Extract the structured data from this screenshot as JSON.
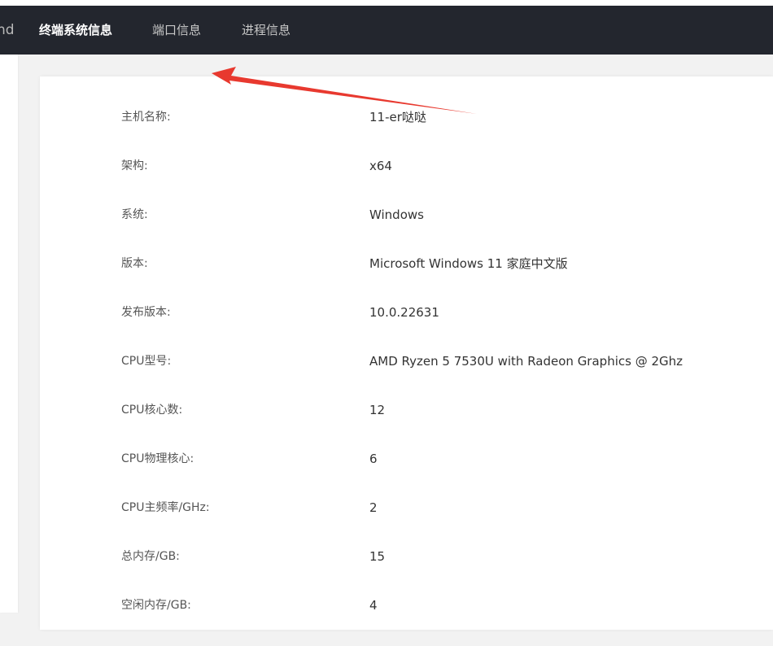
{
  "navbar": {
    "brand": "nd",
    "items": [
      {
        "label": "终端系统信息",
        "active": true
      },
      {
        "label": "端口信息",
        "active": false
      },
      {
        "label": "进程信息",
        "active": false
      }
    ]
  },
  "info": {
    "rows": [
      {
        "label": "主机名称:",
        "value": "11-er哒哒"
      },
      {
        "label": "架构:",
        "value": "x64"
      },
      {
        "label": "系统:",
        "value": "Windows"
      },
      {
        "label": "版本:",
        "value": "Microsoft Windows 11 家庭中文版"
      },
      {
        "label": "发布版本:",
        "value": "10.0.22631"
      },
      {
        "label": "CPU型号:",
        "value": "AMD Ryzen 5 7530U with Radeon Graphics @ 2Ghz"
      },
      {
        "label": "CPU核心数:",
        "value": "12"
      },
      {
        "label": "CPU物理核心:",
        "value": "6"
      },
      {
        "label": "CPU主频率/GHz:",
        "value": "2"
      },
      {
        "label": "总内存/GB:",
        "value": "15"
      },
      {
        "label": "空闲内存/GB:",
        "value": "4"
      }
    ]
  },
  "colors": {
    "navbar_bg": "#23262e",
    "annotation_arrow": "#e8392f"
  }
}
